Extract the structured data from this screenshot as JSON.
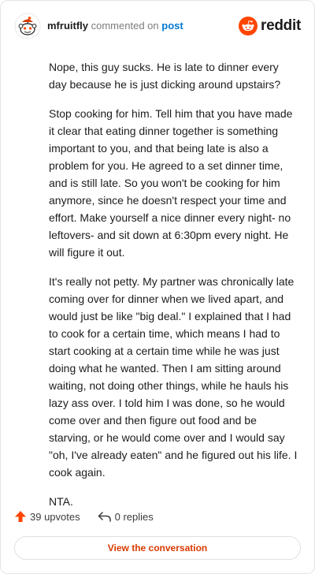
{
  "header": {
    "username": "mfruitfly",
    "action": "commented on",
    "target": "post",
    "brand": "reddit"
  },
  "comment": {
    "paragraphs": [
      "Nope, this guy sucks. He is late to dinner every day because he is just dicking around upstairs?",
      "Stop cooking for him. Tell him that you have made it clear that eating dinner together is something important to you, and that being late is also a problem for you. He agreed to a set dinner time, and is still late. So you won't be cooking for him anymore, since he doesn't respect your time and effort. Make yourself a nice dinner every night- no leftovers- and sit down at 6:30pm every night. He will figure it out.",
      "It's really not petty. My partner was chronically late coming over for dinner when we lived apart, and would just be like \"big deal.\" I explained that I had to cook for a certain time, which means I had to start cooking at a certain time while he was just doing what he wanted. Then I am sitting around waiting, not doing other things, while he hauls his lazy ass over. I told him I was done, so he would come over and then figure out food and be starving, or he would come over and I would say \"oh, I've already eaten\" and he figured out his life. I cook again.",
      "NTA."
    ]
  },
  "stats": {
    "upvotes": "39 upvotes",
    "replies": "0 replies"
  },
  "actions": {
    "view_conversation": "View the conversation"
  },
  "colors": {
    "brand_orange": "#ff4500",
    "link_blue": "#0079d3",
    "button_text": "#d93a00"
  }
}
